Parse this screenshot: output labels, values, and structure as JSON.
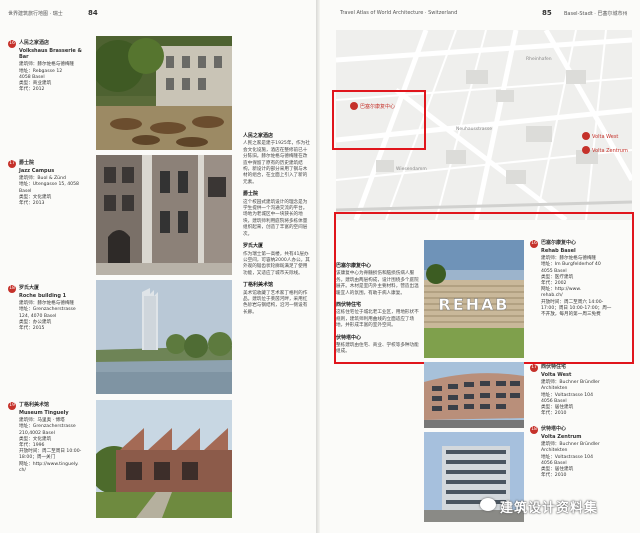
{
  "left_page": {
    "header": "世界建筑旅行地图 · 瑞士",
    "page_number": "84",
    "entries": [
      {
        "num": "16",
        "name_cn": "人民之家酒店",
        "name": "Volkshaus Brasserie & Bar",
        "info": "建筑师：赫尔佐格与德梅隆\n地址：Rebgasse 12\n4058 Basel\n类型：商业建筑\n年代：2012"
      },
      {
        "num": "17",
        "name_cn": "爵士院",
        "name": "Jazz Campus",
        "info": "建筑师：Buol & Zünd\n地址：Utengasse 15, 4058\nBasel\n类型：文化建筑\n年代：2013"
      },
      {
        "num": "18",
        "name_cn": "罗氏大厦",
        "name": "Roche building 1",
        "info": "建筑师：赫尔佐格与德梅隆\n地址：Grenzacherstrasse\n124, 4070 Basel\n类型：办公建筑\n年代：2015"
      },
      {
        "num": "19",
        "name_cn": "丁格利美术馆",
        "name": "Museum Tinguely",
        "info": "建筑师：马里奥 · 博塔\n地址：Grenzacherstrasse\n210,4002 Basel\n类型：文化建筑\n年代：1996\n开放时间：周二至周日 10:00-\n18:00；周一关门\n网址：http://www.tinguely.\nch/"
      }
    ],
    "text_sections": [
      {
        "title": "人民之家酒店",
        "body": "人民之家是建于1925年，作为社会文化设施，酒店在整修前已十分陈旧。赫尔佐格与德梅隆在改造中保留了原有的历史建筑结构，新设计的部分采用了钢与木材的组合，在立面上引入了新的元素。"
      },
      {
        "title": "爵士院",
        "body": "这个校园式建筑设计的理念是为学生提供一个沟通交流的平台。场地为老城区中一块狭长的地块，建筑师利用庭院将多栋体量组织起来，创造了丰富的空间层次。"
      },
      {
        "title": "罗氏大厦",
        "body": "作为瑞士第一高楼，共有41层办公空间，可容纳2000人办公。其外观的锯齿状轮廓既满足了使用功能，又适应了城市天际线。"
      },
      {
        "title": "丁格利美术馆",
        "body": "美术馆收藏了艺术家丁格利的作品。建筑位于莱茵河畔，采用红色砂岩与钢结构，沿河一侧设有长廊。"
      }
    ]
  },
  "right_page": {
    "header": "Travel Atlas of World Architecture · Switzerland",
    "page_number": "85",
    "corner": "Basel-Stadt · 巴塞尔城市州",
    "map": {
      "labels": [
        "巴塞尔康复中心",
        "Wiesendamm",
        "Rheinhafen",
        "Neuhausstrasse",
        "Volta West",
        "Volta Zentrum"
      ],
      "markers": [
        {
          "num": "16",
          "label": "巴塞尔康复中心"
        },
        {
          "num": "17",
          "label": "Volta West"
        },
        {
          "num": "18",
          "label": "Volta Zentrum"
        }
      ]
    },
    "text_sections": [
      {
        "title": "巴塞尔康复中心",
        "body": "该康复中心为脊髓损伤和脑损伤病人服务。建筑由两层构成，设计围绕多个庭院展开。木材是室内外主要材料，营造出温暖宜人的氛围，有助于病人康复。"
      },
      {
        "title": "西伏特住宅",
        "body": "这栋住宅位于城北老工业区，用地形状不规则，建筑师利用曲线的立面适应了场地，并形成丰富的室外空间。"
      },
      {
        "title": "伏特塔中心",
        "body": "整栋建筑由住宅、商业、学校等多种功能组成。"
      }
    ],
    "entries": [
      {
        "num": "16",
        "name_cn": "巴塞尔康复中心",
        "name": "Rehab Basel",
        "info": "建筑师：赫尔佐格与德梅隆\n地址：Im Burgfelderhof 40\n4055 Basel\n类型：医疗建筑\n年代：2002\n网址：http://www.\nrehab.ch/\n开放时间：周二至周六 14:00-\n17:00；周日 10:00-17:00；周一\n不开放，每月的第一周三免费"
      },
      {
        "num": "17",
        "name_cn": "西伏特住宅",
        "name": "Volta West",
        "info": "建筑师：Buchner Bründler\nArchitekten\n地址：Voltastrasse 104\n4056 Basel\n类型：居住建筑\n年代：2010"
      },
      {
        "num": "18",
        "name_cn": "伏特塔中心",
        "name": "Volta Zentrum",
        "info": "建筑师：Buchner Bründler\nArchitekten\n地址：Voltastrasse 104\n4056 Basel\n类型：居住建筑\n年代：2010"
      }
    ],
    "rehab_sign": "REHAB"
  },
  "watermark": "建筑设计资料集"
}
